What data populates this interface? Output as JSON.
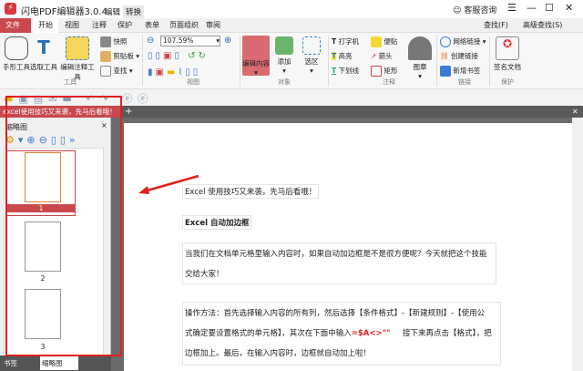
{
  "app": {
    "title": "闪电PDF编辑器3.0.4",
    "logo": "⚡",
    "context_tabs": [
      "编辑",
      "转换"
    ],
    "support": "客服咨询"
  },
  "menu": [
    "文件",
    "开始",
    "视图",
    "注释",
    "保护",
    "表单",
    "页面组织",
    "审阅"
  ],
  "search": {
    "find": "查找(F)",
    "advanced": "高级查找(S)"
  },
  "ribbon": {
    "tools": {
      "hand": "手形工具",
      "select": "选取工具",
      "annot": "编辑注释工具",
      "snapshot": "快照",
      "clipboard": "剪贴板",
      "find": "查找",
      "label": "工具"
    },
    "view": {
      "zoom": "107.59%",
      "label": "视图"
    },
    "object": {
      "edit": "编辑内容",
      "add": "添加",
      "area": "选区",
      "label": "对象"
    },
    "annot": {
      "typewriter": "打字机",
      "note": "便贴",
      "highlight": "高亮",
      "arrow": "箭头",
      "underline": "下划线",
      "rect": "矩形",
      "stamp": "图章",
      "label": "注释"
    },
    "link": {
      "web": "网络链接",
      "create": "创建链接",
      "bookmark": "新增书签",
      "label": "链接"
    },
    "protect": {
      "sign": "签名文档",
      "label": "保护"
    }
  },
  "doc_tab": "excel使用技巧又来袭，先马后看哦！",
  "panel": {
    "title": "缩略图",
    "pages": [
      "1",
      "2",
      "3"
    ],
    "bottom_tabs": [
      "书签",
      "缩略图"
    ]
  },
  "content": {
    "l1": "Excel 使用技巧又来袭，先马后看哦！",
    "l2": "Excel 自动加边框",
    "p1a": "当我们在文档单元格里输入内容时，如果自动加边框是不是很方便呢？今天就把这个技能",
    "p1b": "交给大家！",
    "p2a": "操作方法：首先选择输入内容的所有列，然后选择【条件格式】-【新建规则】-【使用公",
    "p2b": "式确定要设置格式的单元格】，其次在下面中输入",
    "formula": "=$A<>\"\"",
    "p2b2": "接下来再点击【格式】，把",
    "p2c": "边框加上。最后，在输入内容时，边框就自动加上啦！"
  }
}
